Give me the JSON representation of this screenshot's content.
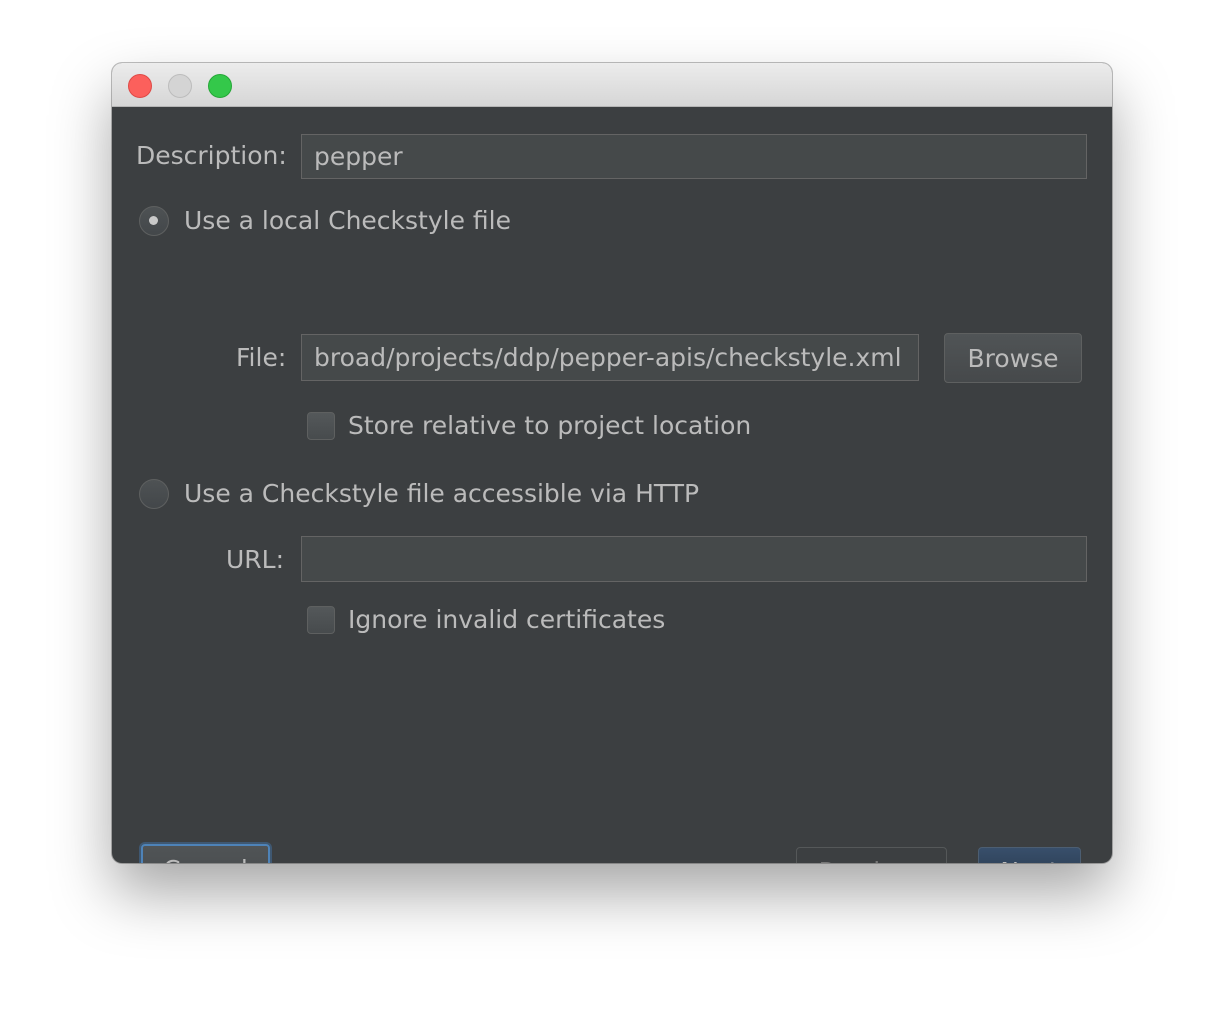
{
  "window": {
    "title": ""
  },
  "description": {
    "label": "Description:",
    "value": "pepper"
  },
  "local": {
    "radio_label": "Use a local Checkstyle file",
    "file_label": "File:",
    "file_value": "broad/projects/ddp/pepper-apis/checkstyle.xml",
    "browse_label": "Browse",
    "store_relative_label": "Store relative to project location"
  },
  "http": {
    "radio_label": "Use a Checkstyle file accessible via HTTP",
    "url_label": "URL:",
    "url_value": "",
    "ignore_certs_label": "Ignore invalid certificates"
  },
  "footer": {
    "cancel_label": "Cancel",
    "previous_label": "Previous",
    "next_label": "Next"
  },
  "colors": {
    "window_bg": "#3c3f41",
    "field_bg": "#45494a",
    "text": "#bbbbbb",
    "primary_button": "#2d4159",
    "focus_ring": "#4e83b8"
  }
}
